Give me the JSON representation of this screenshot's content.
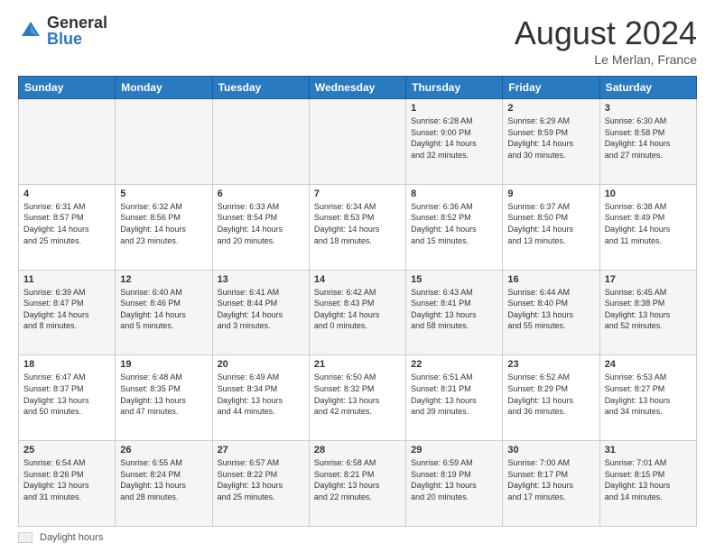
{
  "logo": {
    "general": "General",
    "blue": "Blue"
  },
  "title": {
    "month_year": "August 2024",
    "location": "Le Merlan, France"
  },
  "days_of_week": [
    "Sunday",
    "Monday",
    "Tuesday",
    "Wednesday",
    "Thursday",
    "Friday",
    "Saturday"
  ],
  "footer": {
    "label": "Daylight hours"
  },
  "weeks": [
    [
      {
        "day": "",
        "info": ""
      },
      {
        "day": "",
        "info": ""
      },
      {
        "day": "",
        "info": ""
      },
      {
        "day": "",
        "info": ""
      },
      {
        "day": "1",
        "info": "Sunrise: 6:28 AM\nSunset: 9:00 PM\nDaylight: 14 hours\nand 32 minutes."
      },
      {
        "day": "2",
        "info": "Sunrise: 6:29 AM\nSunset: 8:59 PM\nDaylight: 14 hours\nand 30 minutes."
      },
      {
        "day": "3",
        "info": "Sunrise: 6:30 AM\nSunset: 8:58 PM\nDaylight: 14 hours\nand 27 minutes."
      }
    ],
    [
      {
        "day": "4",
        "info": "Sunrise: 6:31 AM\nSunset: 8:57 PM\nDaylight: 14 hours\nand 25 minutes."
      },
      {
        "day": "5",
        "info": "Sunrise: 6:32 AM\nSunset: 8:56 PM\nDaylight: 14 hours\nand 23 minutes."
      },
      {
        "day": "6",
        "info": "Sunrise: 6:33 AM\nSunset: 8:54 PM\nDaylight: 14 hours\nand 20 minutes."
      },
      {
        "day": "7",
        "info": "Sunrise: 6:34 AM\nSunset: 8:53 PM\nDaylight: 14 hours\nand 18 minutes."
      },
      {
        "day": "8",
        "info": "Sunrise: 6:36 AM\nSunset: 8:52 PM\nDaylight: 14 hours\nand 15 minutes."
      },
      {
        "day": "9",
        "info": "Sunrise: 6:37 AM\nSunset: 8:50 PM\nDaylight: 14 hours\nand 13 minutes."
      },
      {
        "day": "10",
        "info": "Sunrise: 6:38 AM\nSunset: 8:49 PM\nDaylight: 14 hours\nand 11 minutes."
      }
    ],
    [
      {
        "day": "11",
        "info": "Sunrise: 6:39 AM\nSunset: 8:47 PM\nDaylight: 14 hours\nand 8 minutes."
      },
      {
        "day": "12",
        "info": "Sunrise: 6:40 AM\nSunset: 8:46 PM\nDaylight: 14 hours\nand 5 minutes."
      },
      {
        "day": "13",
        "info": "Sunrise: 6:41 AM\nSunset: 8:44 PM\nDaylight: 14 hours\nand 3 minutes."
      },
      {
        "day": "14",
        "info": "Sunrise: 6:42 AM\nSunset: 8:43 PM\nDaylight: 14 hours\nand 0 minutes."
      },
      {
        "day": "15",
        "info": "Sunrise: 6:43 AM\nSunset: 8:41 PM\nDaylight: 13 hours\nand 58 minutes."
      },
      {
        "day": "16",
        "info": "Sunrise: 6:44 AM\nSunset: 8:40 PM\nDaylight: 13 hours\nand 55 minutes."
      },
      {
        "day": "17",
        "info": "Sunrise: 6:45 AM\nSunset: 8:38 PM\nDaylight: 13 hours\nand 52 minutes."
      }
    ],
    [
      {
        "day": "18",
        "info": "Sunrise: 6:47 AM\nSunset: 8:37 PM\nDaylight: 13 hours\nand 50 minutes."
      },
      {
        "day": "19",
        "info": "Sunrise: 6:48 AM\nSunset: 8:35 PM\nDaylight: 13 hours\nand 47 minutes."
      },
      {
        "day": "20",
        "info": "Sunrise: 6:49 AM\nSunset: 8:34 PM\nDaylight: 13 hours\nand 44 minutes."
      },
      {
        "day": "21",
        "info": "Sunrise: 6:50 AM\nSunset: 8:32 PM\nDaylight: 13 hours\nand 42 minutes."
      },
      {
        "day": "22",
        "info": "Sunrise: 6:51 AM\nSunset: 8:31 PM\nDaylight: 13 hours\nand 39 minutes."
      },
      {
        "day": "23",
        "info": "Sunrise: 6:52 AM\nSunset: 8:29 PM\nDaylight: 13 hours\nand 36 minutes."
      },
      {
        "day": "24",
        "info": "Sunrise: 6:53 AM\nSunset: 8:27 PM\nDaylight: 13 hours\nand 34 minutes."
      }
    ],
    [
      {
        "day": "25",
        "info": "Sunrise: 6:54 AM\nSunset: 8:26 PM\nDaylight: 13 hours\nand 31 minutes."
      },
      {
        "day": "26",
        "info": "Sunrise: 6:55 AM\nSunset: 8:24 PM\nDaylight: 13 hours\nand 28 minutes."
      },
      {
        "day": "27",
        "info": "Sunrise: 6:57 AM\nSunset: 8:22 PM\nDaylight: 13 hours\nand 25 minutes."
      },
      {
        "day": "28",
        "info": "Sunrise: 6:58 AM\nSunset: 8:21 PM\nDaylight: 13 hours\nand 22 minutes."
      },
      {
        "day": "29",
        "info": "Sunrise: 6:59 AM\nSunset: 8:19 PM\nDaylight: 13 hours\nand 20 minutes."
      },
      {
        "day": "30",
        "info": "Sunrise: 7:00 AM\nSunset: 8:17 PM\nDaylight: 13 hours\nand 17 minutes."
      },
      {
        "day": "31",
        "info": "Sunrise: 7:01 AM\nSunset: 8:15 PM\nDaylight: 13 hours\nand 14 minutes."
      }
    ]
  ]
}
